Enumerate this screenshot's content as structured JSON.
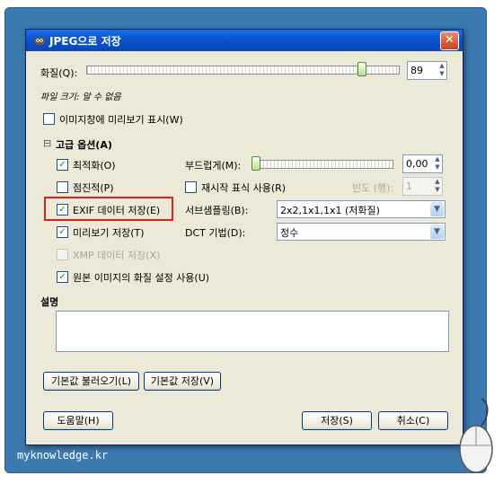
{
  "window": {
    "title": "JPEG으로 저장",
    "close": "✕"
  },
  "quality": {
    "label": "화질(Q):",
    "value": "89"
  },
  "file_size": "파일 크기: 알 수 없음",
  "preview_in_window": {
    "label": "이미지창에 미리보기 표시(W)",
    "checked": false
  },
  "advanced": {
    "label": "고급  옵션(A)",
    "expander": "⊟"
  },
  "options": {
    "optimize": {
      "label": "최적화(O)",
      "checked": true
    },
    "progressive": {
      "label": "점진적(P)",
      "checked": false
    },
    "save_exif": {
      "label": "EXIF 데이터 저장(E)",
      "checked": true
    },
    "save_thumbnail": {
      "label": "미리보기 저장(T)",
      "checked": true
    },
    "save_xmp": {
      "label": "XMP 데이터 저장(X)",
      "checked": false
    },
    "use_original_quality": {
      "label": "원본 이미지의 화질 설정 사용(U)",
      "checked": true
    },
    "smoothing": {
      "label": "부드럽게(M):",
      "value": "0,00"
    },
    "restart_markers": {
      "label": "재시작 표식 사용(R)",
      "checked": false
    },
    "frequency": {
      "label": "빈도 (행):",
      "value": "1"
    },
    "subsampling": {
      "label": "서브샘플링(B):",
      "value": "2x2,1x1,1x1 (저화질)"
    },
    "dct_method": {
      "label": "DCT 기법(D):",
      "value": "정수"
    }
  },
  "comment": {
    "label": "설명",
    "value": ""
  },
  "buttons": {
    "load_defaults": "기본값 불러오기(L)",
    "save_defaults": "기본값 저장(V)",
    "help": "도움말(H)",
    "save": "저장(S)",
    "cancel": "취소(C)"
  },
  "watermark": "myknowledge.kr",
  "icons": {
    "check": "✓",
    "up": "▲",
    "down": "▼",
    "dropdown": "▼"
  }
}
